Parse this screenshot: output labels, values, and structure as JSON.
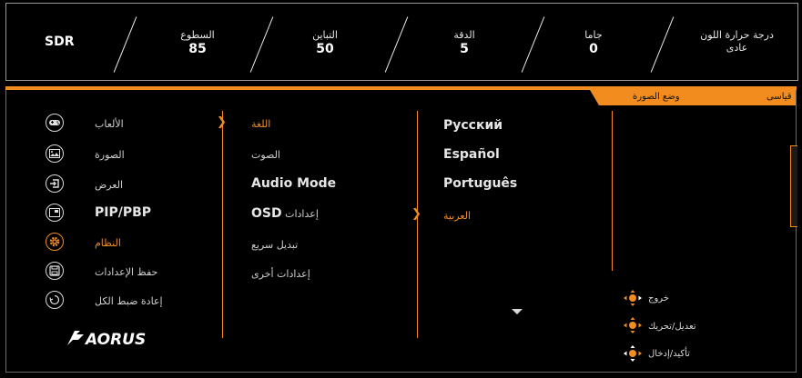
{
  "status": {
    "mode": "SDR",
    "brightness": {
      "label": "السطوع",
      "value": "85"
    },
    "contrast": {
      "label": "التباين",
      "value": "50"
    },
    "sharpness": {
      "label": "الدقة",
      "value": "5"
    },
    "gamma": {
      "label": "جاما",
      "value": "0"
    },
    "color_temp": {
      "label": "درجة حرارة اللون",
      "value": "عادى"
    }
  },
  "tabs": {
    "picture_mode_label": "وضع الصورة",
    "picture_mode_value": "قياسى"
  },
  "main_menu": [
    {
      "label": "الألعاب",
      "icon": "gamepad-icon"
    },
    {
      "label": "الصورة",
      "icon": "picture-icon"
    },
    {
      "label": "العرض",
      "icon": "display-input-icon"
    },
    {
      "label": "PIP/PBP",
      "icon": "pip-icon"
    },
    {
      "label": "النظام",
      "icon": "gear-icon"
    },
    {
      "label": "حفظ الإعدادات",
      "icon": "save-icon"
    },
    {
      "label": "إعادة ضبط الكل",
      "icon": "reset-icon"
    }
  ],
  "submenu": [
    {
      "label": "اللغة"
    },
    {
      "label": "الصوت"
    },
    {
      "label": "Audio Mode"
    },
    {
      "label_bold": "OSD",
      "label": "إعدادات"
    },
    {
      "label": "تبديل سريع"
    },
    {
      "label": "إعدادات أخرى"
    }
  ],
  "languages": [
    "Русский",
    "Español",
    "Português",
    "العربية"
  ],
  "hints": {
    "exit": "خروج",
    "move": "تعديل/تحريك",
    "enter": "تأكيد/إدخال"
  },
  "brand": "AORUS",
  "colors": {
    "accent": "#f28c1f",
    "background": "#000000"
  }
}
